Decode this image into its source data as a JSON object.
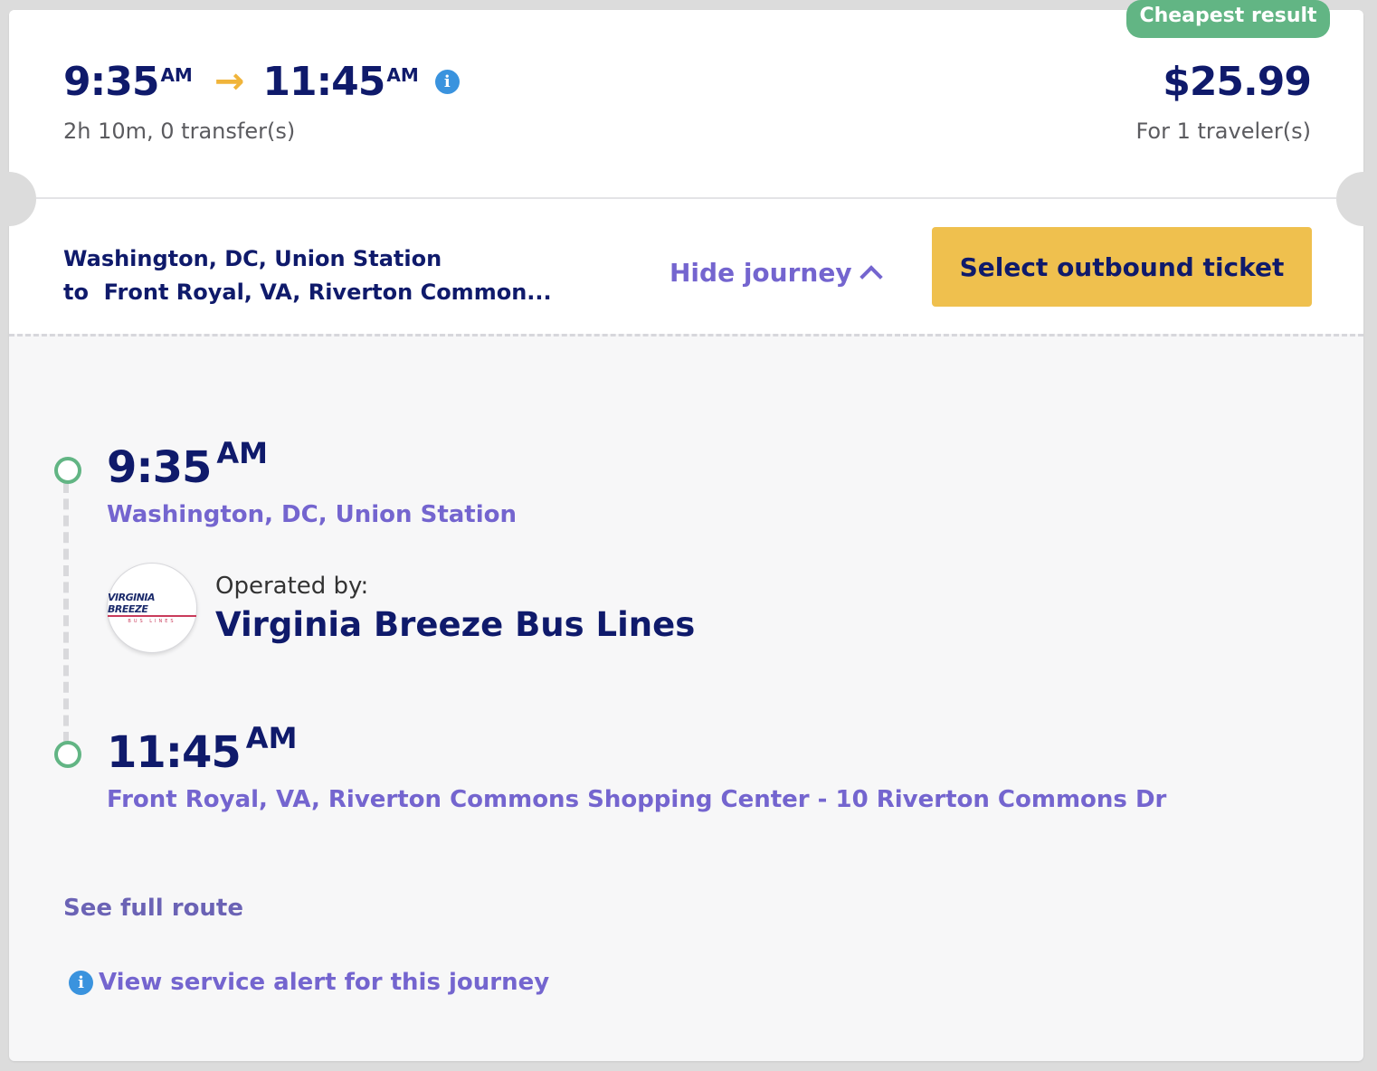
{
  "badge": "Cheapest result",
  "summary": {
    "depart_time": "9:35",
    "depart_period": "AM",
    "arrive_time": "11:45",
    "arrive_period": "AM",
    "arrow": "→",
    "info_glyph": "i",
    "duration": "2h 10m, 0 transfer(s)",
    "price": "$25.99",
    "travelers": "For 1 traveler(s)"
  },
  "route": {
    "from_line": "Washington, DC, Union Station",
    "to_line": "to  Front Royal, VA, Riverton Common..."
  },
  "actions": {
    "hide_journey": "Hide journey",
    "select_ticket": "Select outbound ticket"
  },
  "journey": {
    "departure": {
      "time": "9:35",
      "period": "AM",
      "station": "Washington, DC, Union Station"
    },
    "operator": {
      "label": "Operated by:",
      "name": "Virginia Breeze Bus Lines",
      "logo_text": "VIRGINIA BREEZE",
      "logo_subtext": "BUS LINES"
    },
    "arrival": {
      "time": "11:45",
      "period": "AM",
      "station": "Front Royal, VA, Riverton Commons Shopping Center - 10 Riverton Commons Dr"
    }
  },
  "links": {
    "full_route": "See full route",
    "service_alert": "View service alert for this journey"
  },
  "colors": {
    "navy": "#0f1a6b",
    "purple_link": "#7465cf",
    "cta_yellow": "#efc04e",
    "badge_green": "#62b584",
    "info_blue": "#3a93de",
    "arrow_orange": "#f0b43a"
  },
  "icons": [
    "arrow-right-icon",
    "info-icon",
    "chevron-up-icon",
    "timeline-stop-icon",
    "operator-logo"
  ]
}
